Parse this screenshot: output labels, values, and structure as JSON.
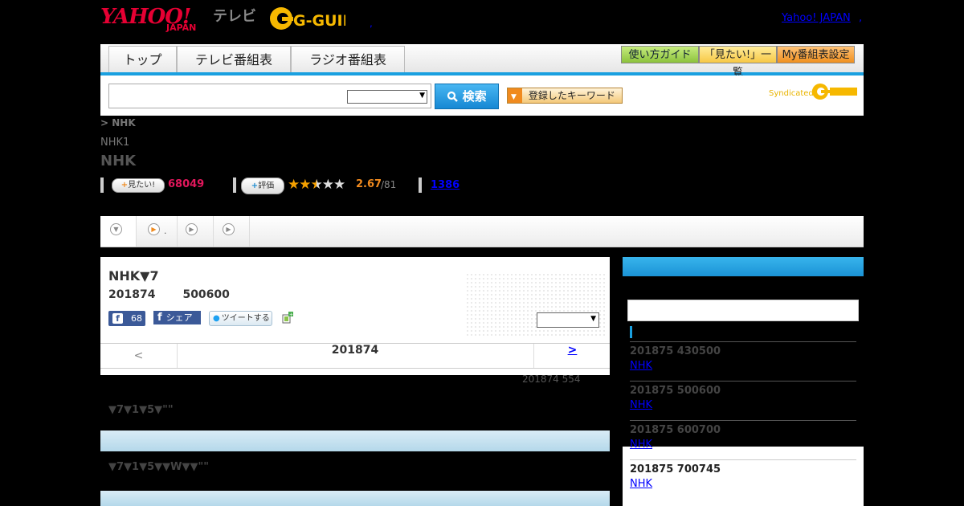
{
  "header": {
    "logo_text": "YAHOO!",
    "logo_sub": "JAPAN",
    "tv_label": "テレビ",
    "gguide_label": "G-GUIDE",
    "dot": ",",
    "yahoo_japan_link": "Yahoo! JAPAN",
    "link_dot": ","
  },
  "nav": {
    "tabs": [
      "トップ",
      "テレビ番組表",
      "ラジオ番組表"
    ],
    "buttons": [
      "使い方ガイド",
      "「見たい!」一覧",
      "My番組表設定"
    ]
  },
  "search": {
    "input_value": "",
    "select_value": "",
    "button_label": "検索",
    "keyword_button": "登録したキーワード",
    "syndicated": "Syndicated"
  },
  "breadcrumb": "> NHK",
  "channel": "NHK1",
  "title": "NHK",
  "stats": {
    "mitai_label": "見たい!",
    "mitai_count": "68049",
    "hyouka_label": "評価",
    "stars_filled": 2.5,
    "rating": "2.67",
    "rating_of": "/81",
    "review_link": "1386"
  },
  "subtabs": [
    {
      "label": ""
    },
    {
      "label": "."
    },
    {
      "label": ""
    },
    {
      "label": ""
    }
  ],
  "program": {
    "title": "NHK▼7",
    "date": "201874",
    "time": "500600",
    "fb_count": "68",
    "fb_share": "シェア",
    "tweet": "ツイートする",
    "select_value": "",
    "pager_prev": "<",
    "pager_mid": "201874",
    "pager_next": ">",
    "note_date": "201874  554",
    "cast_line1": "▼7▼1▼5▼\"\"",
    "cast_line2": "▼7▼1▼5▼▼W▼▼\"\""
  },
  "right": {
    "input_value": "",
    "items": [
      {
        "time": "201875  430500",
        "link": "NHK"
      },
      {
        "time": "201875  500600",
        "link": "NHK"
      },
      {
        "time": "201875  600700",
        "link": "NHK"
      },
      {
        "time": "201875  700745",
        "link": "NHK"
      }
    ]
  }
}
